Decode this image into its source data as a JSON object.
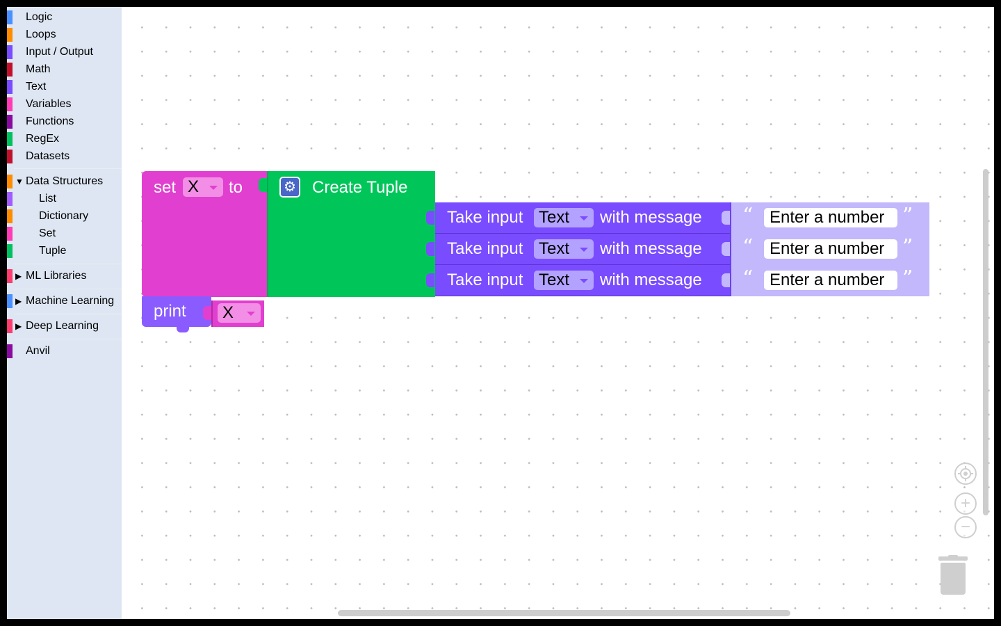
{
  "toolbox": {
    "categories": [
      {
        "label": "Logic",
        "color": "#4a90ff"
      },
      {
        "label": "Loops",
        "color": "#ff8c00"
      },
      {
        "label": "Input / Output",
        "color": "#7a4cff"
      },
      {
        "label": "Math",
        "color": "#c0102c"
      },
      {
        "label": "Text",
        "color": "#7a4cff"
      },
      {
        "label": "Variables",
        "color": "#ff3cb4"
      },
      {
        "label": "Functions",
        "color": "#8a0aa0"
      },
      {
        "label": "RegEx",
        "color": "#00c060"
      },
      {
        "label": "Datasets",
        "color": "#c0102c"
      }
    ],
    "data_structures": {
      "label": "Data Structures",
      "color": "#ff8c00",
      "expanded": true,
      "children": [
        {
          "label": "List",
          "color": "#a05cff"
        },
        {
          "label": "Dictionary",
          "color": "#ff8c00"
        },
        {
          "label": "Set",
          "color": "#ff3cb4"
        },
        {
          "label": "Tuple",
          "color": "#00c060"
        }
      ]
    },
    "collapsed": [
      {
        "label": "ML Libraries",
        "color": "#ff3c6e"
      },
      {
        "label": "Machine Learning",
        "color": "#4a90ff"
      },
      {
        "label": "Deep Learning",
        "color": "#ff3c6e"
      }
    ],
    "anvil": {
      "label": "Anvil",
      "color": "#8a0aa0"
    }
  },
  "blocks": {
    "set": {
      "keyword": "set",
      "variable": "X",
      "to": "to",
      "color": "#e13fcf"
    },
    "tuple": {
      "label": "Create Tuple",
      "color": "#00c65a",
      "gear_icon": "gear-icon"
    },
    "inputs": [
      {
        "keyword": "Take input",
        "type": "Text",
        "with": "with message",
        "message": "Enter a number"
      },
      {
        "keyword": "Take input",
        "type": "Text",
        "with": "with message",
        "message": "Enter a number"
      },
      {
        "keyword": "Take input",
        "type": "Text",
        "with": "with message",
        "message": "Enter a number"
      }
    ],
    "input_color": "#7a4cff",
    "string_color": "#c2b8fb",
    "quote_open": "“",
    "quote_close": "”",
    "print": {
      "keyword": "print",
      "variable": "X",
      "color": "#8a5cff"
    }
  },
  "controls": {
    "recenter_icon": "target-icon",
    "zoom_in": "+",
    "zoom_out": "−",
    "trash_icon": "trash-icon"
  }
}
